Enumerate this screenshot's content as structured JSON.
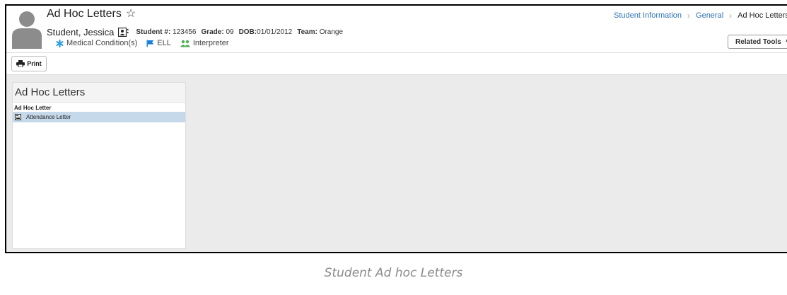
{
  "header": {
    "title": "Ad Hoc Letters",
    "student": {
      "name": "Student, Jessica",
      "number_label": "Student #:",
      "number": "123456",
      "grade_label": "Grade:",
      "grade": "09",
      "dob_label": "DOB:",
      "dob": "01/01/2012",
      "team_label": "Team:",
      "team": "Orange"
    },
    "flags": [
      {
        "label": "Medical Condition(s)",
        "icon": "asterisk-icon",
        "color": "#2f9be0"
      },
      {
        "label": "ELL",
        "icon": "flag-icon",
        "color": "#1a7fd6"
      },
      {
        "label": "Interpreter",
        "icon": "people-icon",
        "color": "#4caf50"
      }
    ]
  },
  "breadcrumb": [
    "Student Information",
    "General",
    "Ad Hoc Letters"
  ],
  "related_tools": {
    "label": "Related Tools"
  },
  "toolbar": {
    "print_label": "Print"
  },
  "panel": {
    "title": "Ad Hoc Letters",
    "column_header": "Ad Hoc Letter",
    "items": [
      {
        "label": "Attendance Letter",
        "icon": "document-icon",
        "selected": true
      }
    ]
  },
  "caption": "Student Ad hoc Letters",
  "colors": {
    "link": "#2f73b5",
    "workspace_bg": "#ebebeb",
    "selected_row": "#c6d9eb"
  }
}
